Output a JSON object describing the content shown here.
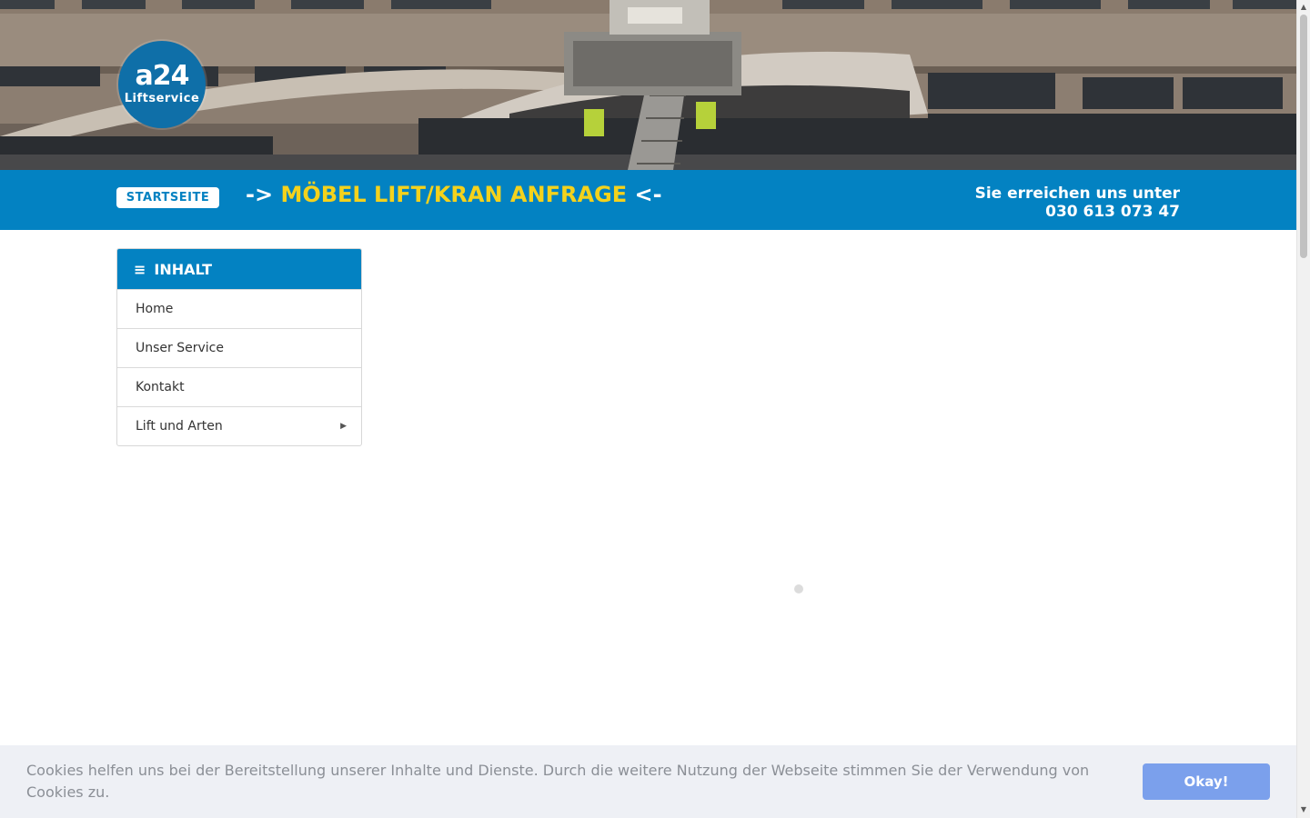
{
  "hero": {
    "logo": {
      "main": "a24",
      "sub": "Liftservice"
    }
  },
  "bar": {
    "start_button": "STARTSEITE",
    "headline_prefix": "->",
    "headline_main": "MÖBEL LIFT/KRAN ANFRAGE",
    "headline_suffix": "<-",
    "contact_line1": "Sie erreichen uns unter",
    "contact_line2": "030 613 073 47"
  },
  "menu": {
    "title": "INHALT",
    "burger_icon": "≡",
    "items": [
      {
        "label": "Home"
      },
      {
        "label": "Unser Service"
      },
      {
        "label": "Kontakt"
      },
      {
        "label": "Lift und Arten",
        "submenu_icon": "▶"
      }
    ]
  },
  "cookie": {
    "text": "Cookies helfen uns bei der Bereitstellung unserer Inhalte und Dienste. Durch die weitere Nutzung der Webseite stimmen Sie der Verwendung von Cookies zu.",
    "button": "Okay!"
  },
  "colors": {
    "brand_blue": "#0382c2",
    "headline_yellow": "#f4d21c",
    "cookie_button": "#7ba0ec"
  }
}
